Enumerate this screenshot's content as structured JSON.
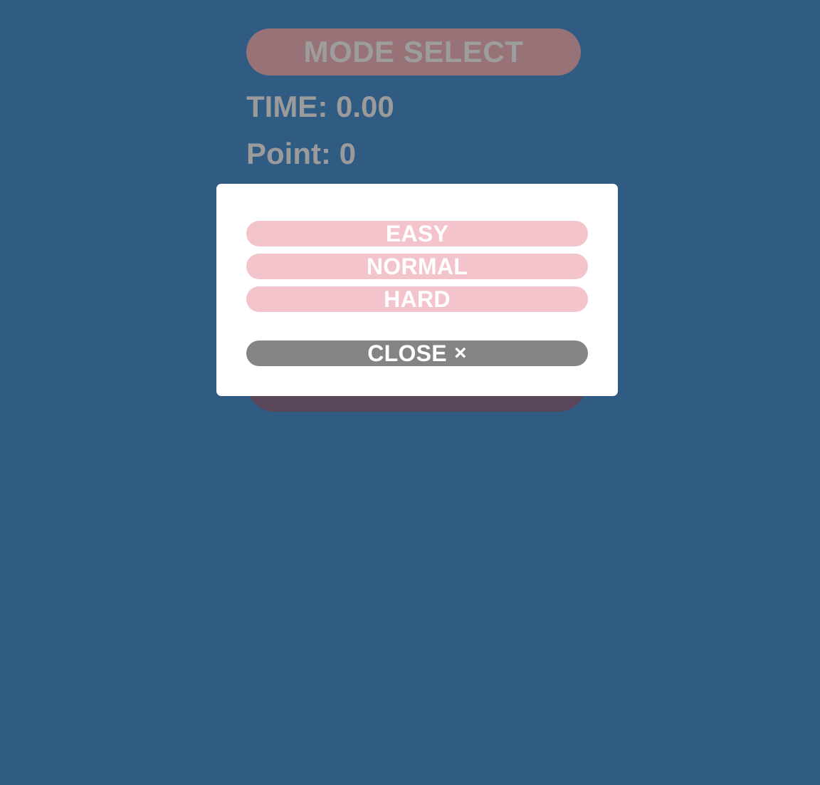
{
  "game": {
    "mode_select_label": "MODE SELECT",
    "time_label": "TIME: 0.00",
    "point_label": "Point: 0"
  },
  "modal": {
    "modes": [
      {
        "label": "EASY"
      },
      {
        "label": "NORMAL"
      },
      {
        "label": "HARD"
      }
    ],
    "close_label": "CLOSE",
    "close_icon": "×"
  },
  "colors": {
    "background": "#305b82",
    "mode_button": "#977276",
    "modal_background": "#ffffff",
    "mode_pill": "#f4c4cd",
    "close_pill": "#848484",
    "dimmed_text": "#9b9b9b"
  }
}
